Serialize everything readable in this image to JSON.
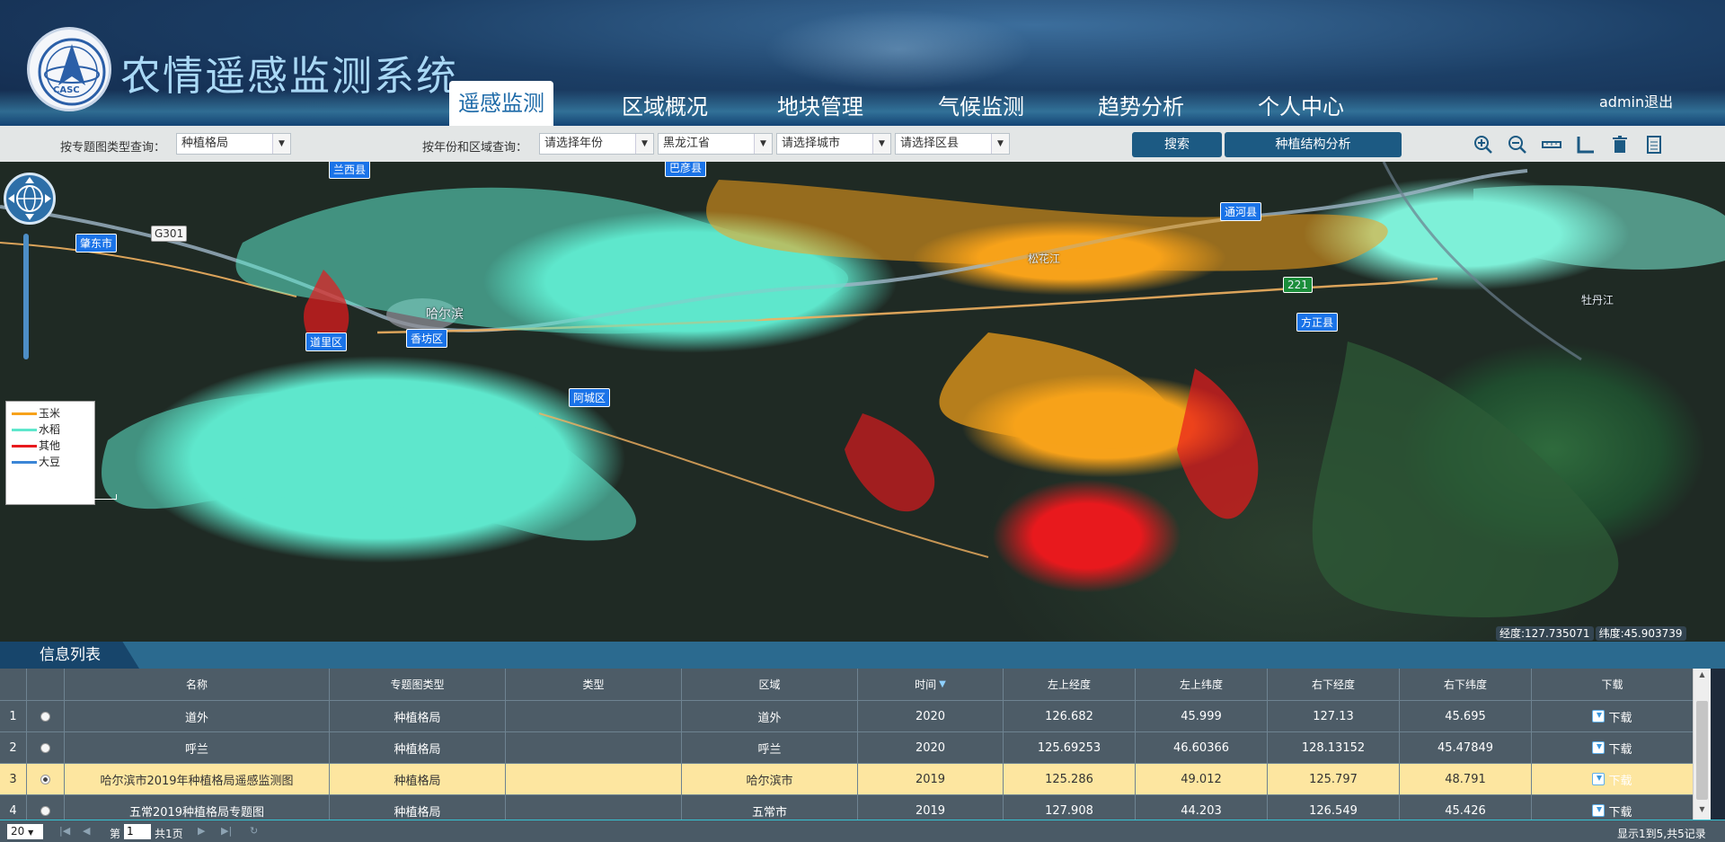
{
  "header": {
    "logo_text": "CASC",
    "title": "农情遥感监测系统",
    "nav": [
      {
        "label": "遥感监测",
        "active": true
      },
      {
        "label": "区域概况"
      },
      {
        "label": "地块管理"
      },
      {
        "label": "气候监测"
      },
      {
        "label": "趋势分析"
      },
      {
        "label": "个人中心"
      }
    ],
    "user": "admin",
    "logout": "退出"
  },
  "toolbar": {
    "theme_label": "按专题图类型查询：",
    "theme_value": "种植格局",
    "region_label": "按年份和区域查询：",
    "year_placeholder": "请选择年份",
    "province_value": "黑龙江省",
    "city_placeholder": "请选择城市",
    "county_placeholder": "请选择区县",
    "search_button": "搜索",
    "analysis_button": "种植结构分析",
    "icons": [
      "zoom-in-icon",
      "zoom-out-icon",
      "measure-distance-icon",
      "measure-area-icon",
      "trash-icon",
      "list-icon"
    ]
  },
  "map": {
    "labels": [
      {
        "text": "兰西县"
      },
      {
        "text": "巴彦县"
      },
      {
        "text": "通河县"
      },
      {
        "text": "肇东市"
      },
      {
        "text": "G301"
      },
      {
        "text": "方正县"
      },
      {
        "text": "阿城区"
      },
      {
        "text": "哈尔滨"
      },
      {
        "text": "道里区"
      },
      {
        "text": "香坊区"
      },
      {
        "text": "松花江"
      },
      {
        "text": "牡丹江"
      },
      {
        "text": "221"
      }
    ],
    "legend": [
      {
        "label": "玉米",
        "color": "#f7a21a"
      },
      {
        "label": "水稻",
        "color": "#5ee7cc"
      },
      {
        "label": "其他",
        "color": "#e8191d"
      },
      {
        "label": "大豆",
        "color": "#3b86d6"
      }
    ],
    "coords": {
      "lon": "经度:127.735071",
      "lat": "纬度:45.903739"
    }
  },
  "info": {
    "tab_title": "信息列表",
    "columns": [
      "名称",
      "专题图类型",
      "类型",
      "区域",
      "时间",
      "左上经度",
      "左上纬度",
      "右下经度",
      "右下纬度",
      "下载"
    ],
    "rows": [
      {
        "idx": "1",
        "name": "道外",
        "theme": "种植格局",
        "type": "",
        "region": "道外",
        "time": "2020",
        "ul_lon": "126.682",
        "ul_lat": "45.999",
        "lr_lon": "127.13",
        "lr_lat": "45.695",
        "download": "下载"
      },
      {
        "idx": "2",
        "name": "呼兰",
        "theme": "种植格局",
        "type": "",
        "region": "呼兰",
        "time": "2020",
        "ul_lon": "125.69253",
        "ul_lat": "46.60366",
        "lr_lon": "128.13152",
        "lr_lat": "45.47849",
        "download": "下载"
      },
      {
        "idx": "3",
        "name": "哈尔滨市2019年种植格局遥感监测图",
        "theme": "种植格局",
        "type": "",
        "region": "哈尔滨市",
        "time": "2019",
        "ul_lon": "125.286",
        "ul_lat": "49.012",
        "lr_lon": "125.797",
        "lr_lat": "48.791",
        "download": "下载",
        "selected": true
      },
      {
        "idx": "4",
        "name": "五常2019种植格局专题图",
        "theme": "种植格局",
        "type": "",
        "region": "五常市",
        "time": "2019",
        "ul_lon": "127.908",
        "ul_lat": "44.203",
        "lr_lon": "126.549",
        "lr_lat": "45.426",
        "download": "下载"
      }
    ]
  },
  "pager": {
    "page_size": "20",
    "page_prefix": "第",
    "page_value": "1",
    "page_total": "共1页",
    "summary": "显示1到5,共5记录"
  }
}
